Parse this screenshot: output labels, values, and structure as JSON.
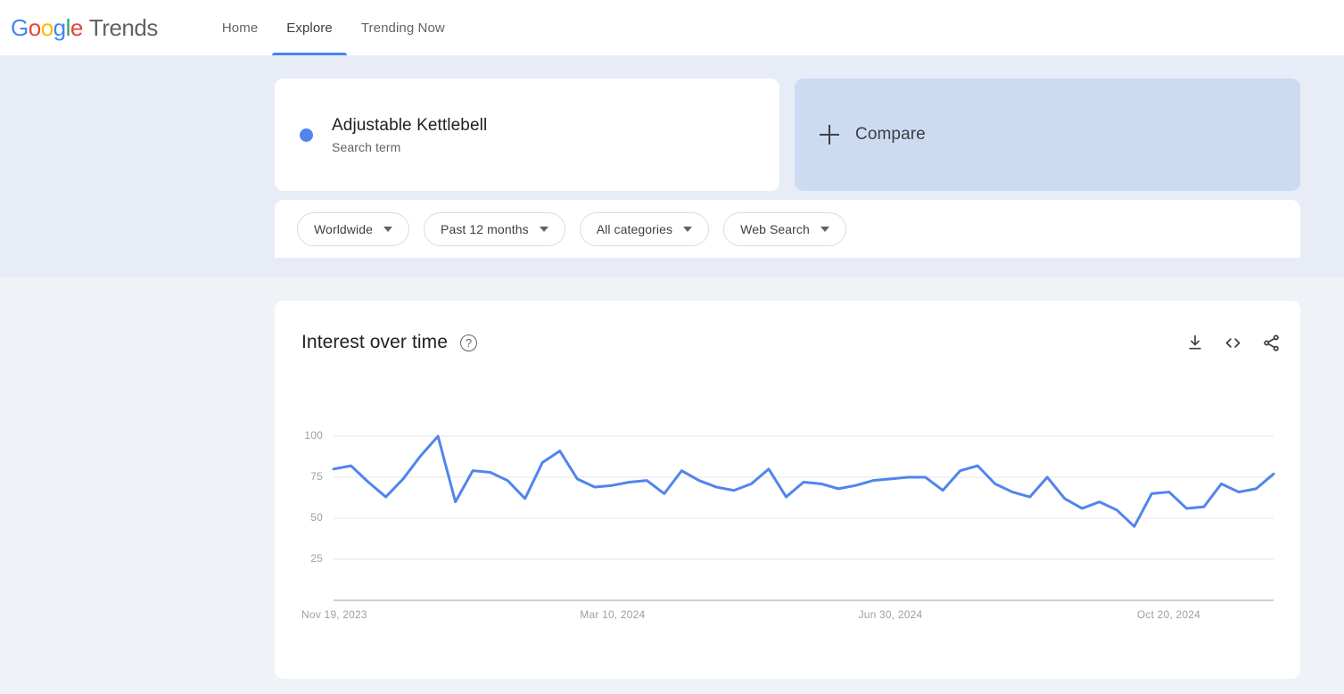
{
  "nav": {
    "brand_google": "Google",
    "brand_trends": "Trends",
    "links": [
      {
        "label": "Home",
        "active": false
      },
      {
        "label": "Explore",
        "active": true
      },
      {
        "label": "Trending Now",
        "active": false
      }
    ]
  },
  "query": {
    "term": "Adjustable Kettlebell",
    "term_type": "Search term",
    "term_color": "#5085ec",
    "compare_label": "Compare"
  },
  "filters": [
    {
      "name": "location",
      "value": "Worldwide"
    },
    {
      "name": "time-range",
      "value": "Past 12 months"
    },
    {
      "name": "category",
      "value": "All categories"
    },
    {
      "name": "search-type",
      "value": "Web Search"
    }
  ],
  "chart_card": {
    "title": "Interest over time",
    "help_glyph": "?",
    "actions": [
      {
        "name": "download-csv",
        "icon": "download-icon"
      },
      {
        "name": "embed-code",
        "icon": "embed-code-icon"
      },
      {
        "name": "share",
        "icon": "share-icon"
      }
    ]
  },
  "chart_data": {
    "type": "line",
    "title": "Interest over time",
    "xlabel": "",
    "ylabel": "",
    "ylim": [
      0,
      100
    ],
    "yticks": [
      25,
      50,
      75,
      100
    ],
    "grid": true,
    "legend": false,
    "line_color": "#5085ec",
    "xticks": [
      "Nov 19, 2023",
      "Mar 10, 2024",
      "Jun 30, 2024",
      "Oct 20, 2024"
    ],
    "xtick_positions": [
      0,
      16,
      32,
      48
    ],
    "series": [
      {
        "name": "Adjustable Kettlebell",
        "values": [
          80,
          82,
          72,
          63,
          74,
          88,
          100,
          60,
          79,
          78,
          73,
          62,
          84,
          91,
          74,
          69,
          70,
          72,
          73,
          65,
          79,
          73,
          69,
          67,
          71,
          80,
          63,
          72,
          71,
          68,
          70,
          73,
          74,
          75,
          75,
          67,
          79,
          82,
          71,
          66,
          63,
          75,
          62,
          56,
          60,
          55,
          45,
          65,
          66,
          56,
          57,
          71,
          66,
          68,
          77
        ]
      }
    ]
  }
}
